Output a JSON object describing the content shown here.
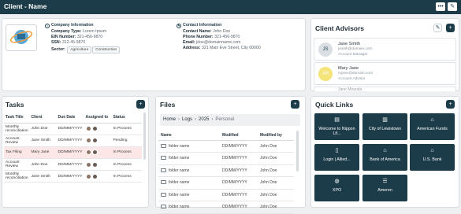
{
  "window": {
    "title": "Client - Name"
  },
  "client": {
    "company_header": "Company Information",
    "company_type_label": "Company Type:",
    "company_type": "Lorem Ipsum",
    "ein_label": "EIN Number:",
    "ein": "321-456-9870",
    "ssn_label": "SSN:",
    "ssn": "312-45-9870",
    "sector_label": "Sector:",
    "sectors": [
      "Agriculture",
      "Construction"
    ],
    "contact_header": "Contact Information",
    "contact_name_label": "Contact Name:",
    "contact_name": "John Doe",
    "phone_label": "Phone Number:",
    "phone": "321-456-9870",
    "email_label": "Email:",
    "email": "jdoe@domainname.com",
    "address_label": "Address:",
    "address": "321 Main Eve Street, City 00000"
  },
  "advisors": {
    "title": "Client Advisors",
    "items": [
      {
        "initials": "JS",
        "name": "Jane Smith",
        "email": "jsmith@domain.com",
        "role": "Account Manager",
        "color": "#d9dfe3"
      },
      {
        "initials": "AR",
        "name": "Mary Jane",
        "email": "mjane@domain.com",
        "role": "Account Advisor",
        "color": "#f5e47a"
      },
      {
        "initials": "",
        "name": "Jane Miranda",
        "email": "",
        "role": "",
        "color": "#1d3c4a"
      }
    ]
  },
  "tasks": {
    "title": "Tasks",
    "columns": [
      "Task Title",
      "Client",
      "Due Date",
      "Assigned to",
      "Status"
    ],
    "rows": [
      [
        "Monthly reconciliation",
        "John Doe",
        "DD/MM/YYYY",
        "",
        "In Process"
      ],
      [
        "Account Review",
        "Jane Smith",
        "DD/MM/YYYY",
        "",
        "Pending"
      ],
      [
        "Tax Filing",
        "Mary Jane",
        "DD/MM/YYYY",
        "",
        "In Process"
      ],
      [
        "Account Review",
        "John Doe",
        "DD/MM/YYYY",
        "",
        "In Process"
      ],
      [
        "Monthly reconciliation",
        "Jane Smith",
        "DD/MM/YYYY",
        "",
        "In Process"
      ]
    ]
  },
  "files": {
    "title": "Files",
    "breadcrumb": [
      "Home",
      "Logs",
      "2025",
      "Personal"
    ],
    "columns": [
      "Name",
      "Modified",
      "Modified by"
    ],
    "rows": [
      [
        "folder name",
        "DD/MM/YYYY",
        "John Doe"
      ],
      [
        "folder name",
        "DD/MM/YYYY",
        "John Doe"
      ],
      [
        "folder name",
        "DD/MM/YYYY",
        "John Doe"
      ],
      [
        "folder name",
        "DD/MM/YYYY",
        "John Doe"
      ],
      [
        "folder name",
        "DD/MM/YYYY",
        "John Doe"
      ],
      [
        "folder name",
        "DD/MM/YYYY",
        "John Doe"
      ]
    ]
  },
  "quick_links": {
    "title": "Quick Links",
    "items": [
      {
        "label": "Welcome to Nippon Lif...",
        "icon": "book-icon",
        "glyph": "▤"
      },
      {
        "label": "City of Lewistown",
        "icon": "city-icon",
        "glyph": "▥"
      },
      {
        "label": "American Funds",
        "icon": "bank-icon",
        "glyph": "⌂"
      },
      {
        "label": "Login | Allied...",
        "icon": "document-icon",
        "glyph": "▯"
      },
      {
        "label": "Bank of America",
        "icon": "bank-icon",
        "glyph": "⌂"
      },
      {
        "label": "U.S. Bank",
        "icon": "bank-icon",
        "glyph": "⌂"
      },
      {
        "label": "XPO",
        "icon": "globe-icon",
        "glyph": "◍"
      },
      {
        "label": "Ameren",
        "icon": "list-icon",
        "glyph": "☰"
      }
    ]
  }
}
